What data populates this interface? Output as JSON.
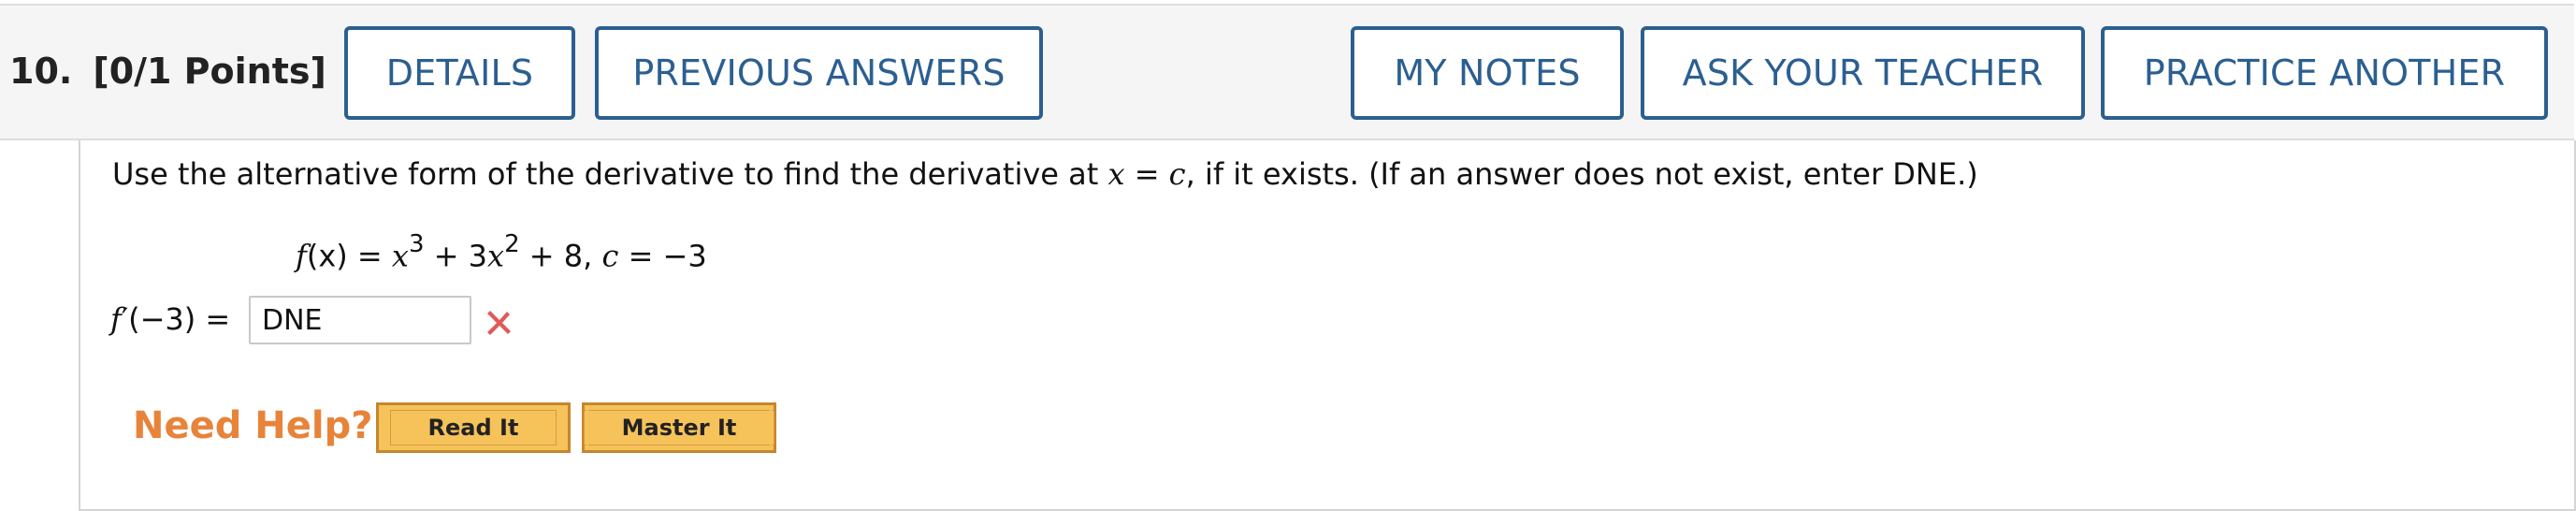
{
  "question": {
    "number": "10.",
    "points": "[0/1 Points]"
  },
  "header_buttons": {
    "details": "DETAILS",
    "previous_answers": "PREVIOUS ANSWERS",
    "my_notes": "MY NOTES",
    "ask_teacher": "ASK YOUR TEACHER",
    "practice_another": "PRACTICE ANOTHER"
  },
  "problem": {
    "instructions_pre": "Use the alternative form of the derivative to find the derivative at ",
    "instructions_var_x": "x",
    "instructions_eq": " = ",
    "instructions_var_c": "c",
    "instructions_post": ", if it exists. (If an answer does not exist, enter DNE.)",
    "formula_f": "f",
    "formula_fx_rest": "(x) = ",
    "formula_x1": "x",
    "formula_exp1": "3",
    "formula_plus": " + 3",
    "formula_x2": "x",
    "formula_exp2": "2",
    "formula_tail": " + 8, ",
    "formula_c": "c",
    "formula_c_val": " = −3"
  },
  "answer": {
    "label_f": "f",
    "label_rest": "′(−3)  = ",
    "value": "DNE",
    "status": "incorrect",
    "status_icon": "x-icon",
    "status_color": "#e05a5a"
  },
  "help": {
    "label": "Need Help?",
    "read_it": "Read It",
    "master_it": "Master It"
  },
  "colors": {
    "accent": "#2b5f91",
    "help_orange": "#e8833a",
    "help_button": "#f6c25a"
  }
}
